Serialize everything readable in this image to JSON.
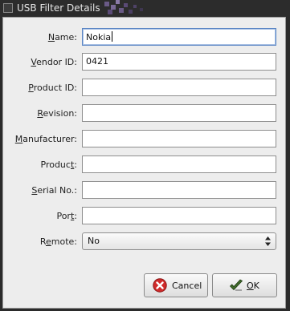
{
  "window": {
    "title": "USB Filter Details"
  },
  "form": {
    "fields": [
      {
        "label": "Name:",
        "mnemonic": "N",
        "value": "Nokia",
        "focused": true
      },
      {
        "label": "Vendor ID:",
        "mnemonic": "V",
        "value": "0421"
      },
      {
        "label": "Product ID:",
        "mnemonic": "P",
        "value": ""
      },
      {
        "label": "Revision:",
        "mnemonic": "R",
        "value": ""
      },
      {
        "label": "Manufacturer:",
        "mnemonic": "M",
        "value": ""
      },
      {
        "label": "Product:",
        "mnemonic": "t",
        "value": ""
      },
      {
        "label": "Serial No.:",
        "mnemonic": "S",
        "value": ""
      },
      {
        "label": "Port:",
        "mnemonic": "t",
        "value": ""
      }
    ],
    "remote": {
      "label": "Remote:",
      "mnemonic": "e",
      "value": "No"
    }
  },
  "buttons": {
    "cancel": {
      "label": "Cancel",
      "icon": "cancel-icon",
      "color": "#d02a2a"
    },
    "ok": {
      "label": "OK",
      "mnemonic": "O",
      "icon": "checkmark-icon",
      "color": "#3f6b2a"
    }
  }
}
